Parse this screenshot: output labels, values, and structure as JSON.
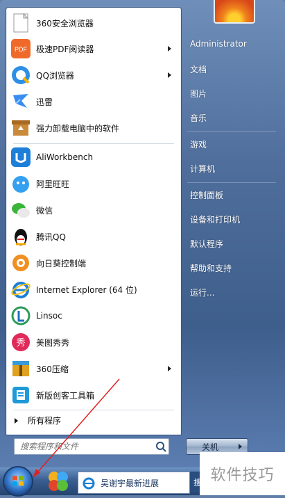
{
  "programs": [
    {
      "label": "360安全浏览器",
      "has_submenu": false,
      "icon": "360-browser-icon"
    },
    {
      "label": "极速PDF阅读器",
      "has_submenu": true,
      "icon": "pdf-reader-icon"
    },
    {
      "label": "QQ浏览器",
      "has_submenu": true,
      "icon": "qq-browser-icon"
    },
    {
      "label": "迅雷",
      "has_submenu": false,
      "icon": "xunlei-icon"
    },
    {
      "label": "强力卸载电脑中的软件",
      "has_submenu": false,
      "icon": "uninstaller-icon"
    },
    {
      "label": "AliWorkbench",
      "has_submenu": false,
      "icon": "aliworkbench-icon"
    },
    {
      "label": "阿里旺旺",
      "has_submenu": false,
      "icon": "aliwangwang-icon"
    },
    {
      "label": "微信",
      "has_submenu": false,
      "icon": "wechat-icon"
    },
    {
      "label": "腾讯QQ",
      "has_submenu": false,
      "icon": "qq-penguin-icon"
    },
    {
      "label": "向日葵控制端",
      "has_submenu": false,
      "icon": "sunflower-icon"
    },
    {
      "label": "Internet Explorer (64 位)",
      "has_submenu": false,
      "icon": "ie-icon"
    },
    {
      "label": "Linsoc",
      "has_submenu": false,
      "icon": "linsoc-icon"
    },
    {
      "label": "美图秀秀",
      "has_submenu": false,
      "icon": "meitu-icon"
    },
    {
      "label": "360压缩",
      "has_submenu": true,
      "icon": "360-zip-icon"
    },
    {
      "label": "新版创客工具箱",
      "has_submenu": false,
      "icon": "toolbox-icon"
    }
  ],
  "all_programs_label": "所有程序",
  "search": {
    "placeholder": "搜索程序和文件"
  },
  "user": {
    "name": "Administrator"
  },
  "places": {
    "documents": "文档",
    "pictures": "图片",
    "music": "音乐",
    "games": "游戏",
    "computer": "计算机",
    "control_panel": "控制面板",
    "devices_printers": "设备和打印机",
    "default_programs": "默认程序",
    "help_support": "帮助和支持",
    "run": "运行..."
  },
  "shutdown_label": "关机",
  "taskbar": {
    "ie_window_title": "吴谢宇最新进展",
    "overflow_label": "搜"
  },
  "watermark": "软件技巧",
  "colors": {
    "accent_arrow": "#e02020",
    "menu_blue": "#4f6e9c"
  }
}
